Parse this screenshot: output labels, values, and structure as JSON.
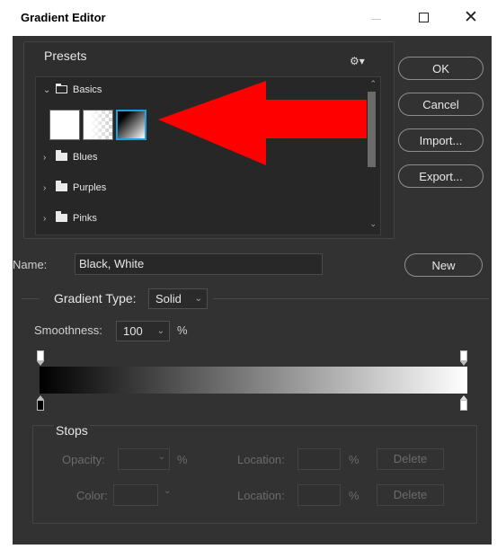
{
  "window": {
    "title": "Gradient Editor",
    "controls": {
      "minimize": "—",
      "maximize": "☐",
      "close": "✕"
    }
  },
  "presets": {
    "label": "Presets",
    "settings_icon": "gear-icon",
    "folders": [
      {
        "label": "Basics",
        "expanded": true
      },
      {
        "label": "Blues",
        "expanded": false
      },
      {
        "label": "Purples",
        "expanded": false
      },
      {
        "label": "Pinks",
        "expanded": false
      }
    ],
    "selected_swatch": "Black, White"
  },
  "buttons": {
    "ok": "OK",
    "cancel": "Cancel",
    "import": "Import...",
    "export": "Export...",
    "new": "New"
  },
  "name": {
    "label": "Name:",
    "value": "Black, White"
  },
  "gradient_type": {
    "label": "Gradient Type:",
    "value": "Solid"
  },
  "smoothness": {
    "label": "Smoothness:",
    "value": "100",
    "unit": "%"
  },
  "gradient": {
    "start_color": "#000000",
    "end_color": "#ffffff"
  },
  "stops": {
    "label": "Stops",
    "opacity_label": "Opacity:",
    "color_label": "Color:",
    "location_label": "Location:",
    "percent": "%",
    "delete": "Delete"
  },
  "annotation": {
    "arrow_color": "#ff0000",
    "selection_color": "#1e9fe0"
  }
}
